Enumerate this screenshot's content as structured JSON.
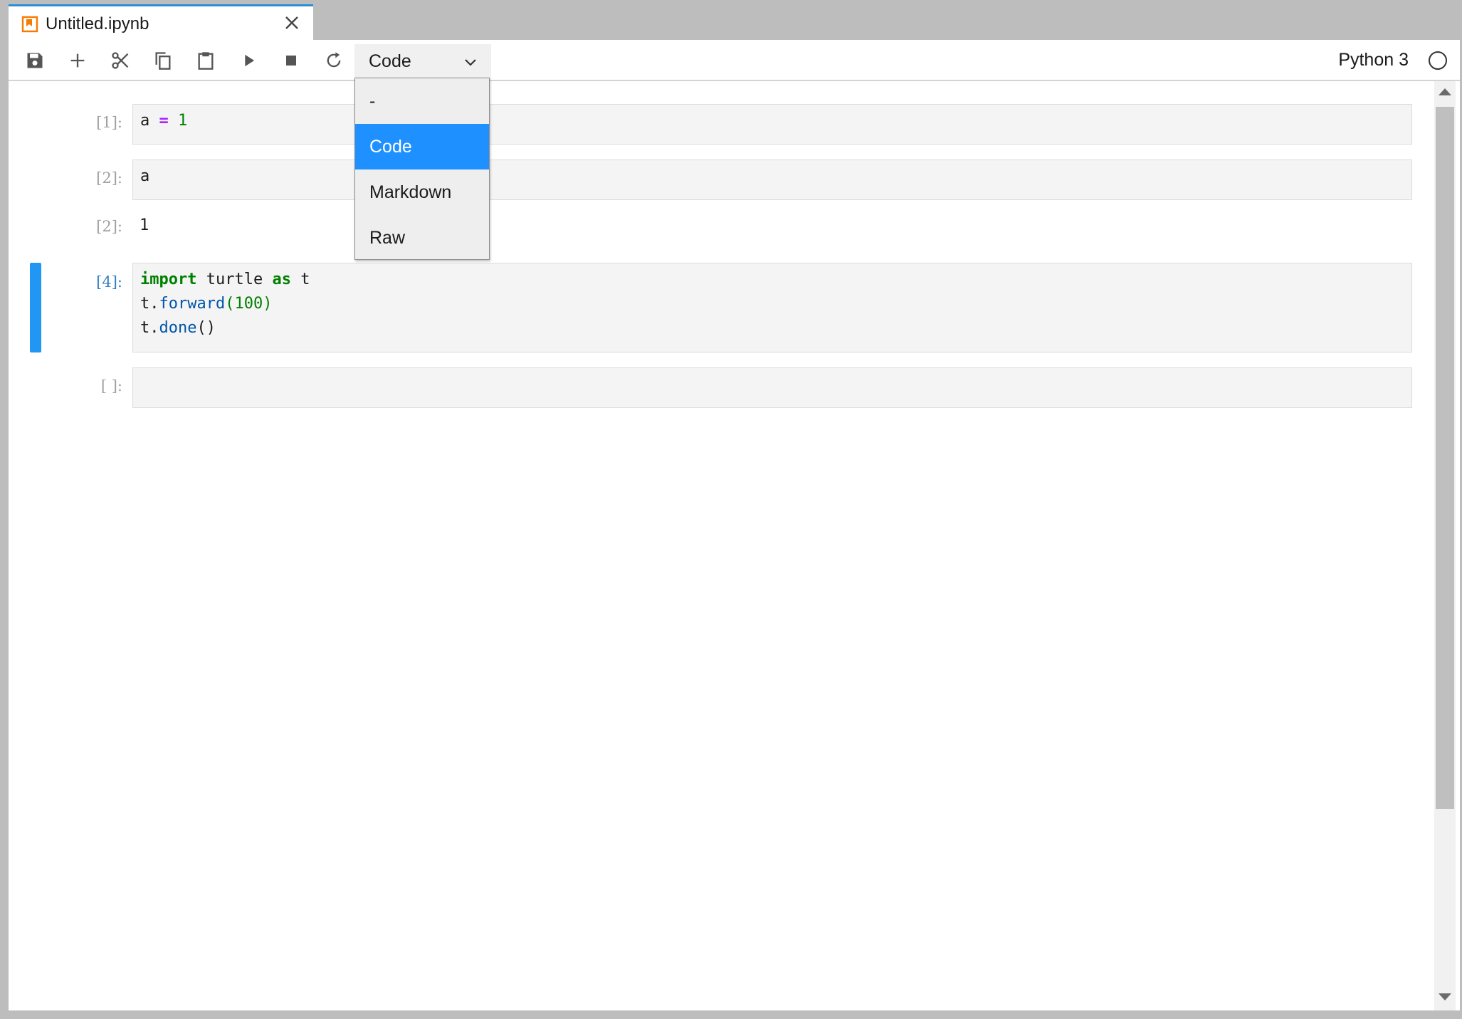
{
  "tab": {
    "title": "Untitled.ipynb"
  },
  "toolbar": {
    "buttons": [
      "save-icon",
      "add-icon",
      "cut-icon",
      "copy-icon",
      "paste-icon",
      "run-icon",
      "stop-icon",
      "restart-icon"
    ],
    "cell_type": "Code",
    "kernel": "Python 3"
  },
  "dropdown": {
    "options": [
      "-",
      "Code",
      "Markdown",
      "Raw"
    ],
    "selected": "Code"
  },
  "cells": [
    {
      "prompt": "[1]:",
      "tokens": [
        {
          "t": "a ",
          "c": ""
        },
        {
          "t": "=",
          "c": "op"
        },
        {
          "t": " ",
          "c": ""
        },
        {
          "t": "1",
          "c": "num"
        }
      ]
    },
    {
      "prompt": "[2]:",
      "tokens": [
        {
          "t": "a",
          "c": ""
        }
      ],
      "output_prompt": "[2]:",
      "output": "1"
    },
    {
      "prompt": "[4]:",
      "lines": [
        [
          {
            "t": "import",
            "c": "kw"
          },
          {
            "t": " turtle ",
            "c": ""
          },
          {
            "t": "as",
            "c": "kw"
          },
          {
            "t": " t",
            "c": ""
          }
        ],
        [
          {
            "t": "t.",
            "c": ""
          },
          {
            "t": "forward",
            "c": "fn"
          },
          {
            "t": "(100)",
            "c": "num"
          }
        ],
        [
          {
            "t": "t.",
            "c": ""
          },
          {
            "t": "done",
            "c": "fn"
          },
          {
            "t": "()",
            "c": ""
          }
        ]
      ]
    },
    {
      "prompt": "[ ]:"
    }
  ],
  "colors": {
    "accent": "#1e90ff",
    "active_bar": "#2196f3",
    "tab_border": "#2b8fd4",
    "tab_icon": "#f57c00"
  }
}
